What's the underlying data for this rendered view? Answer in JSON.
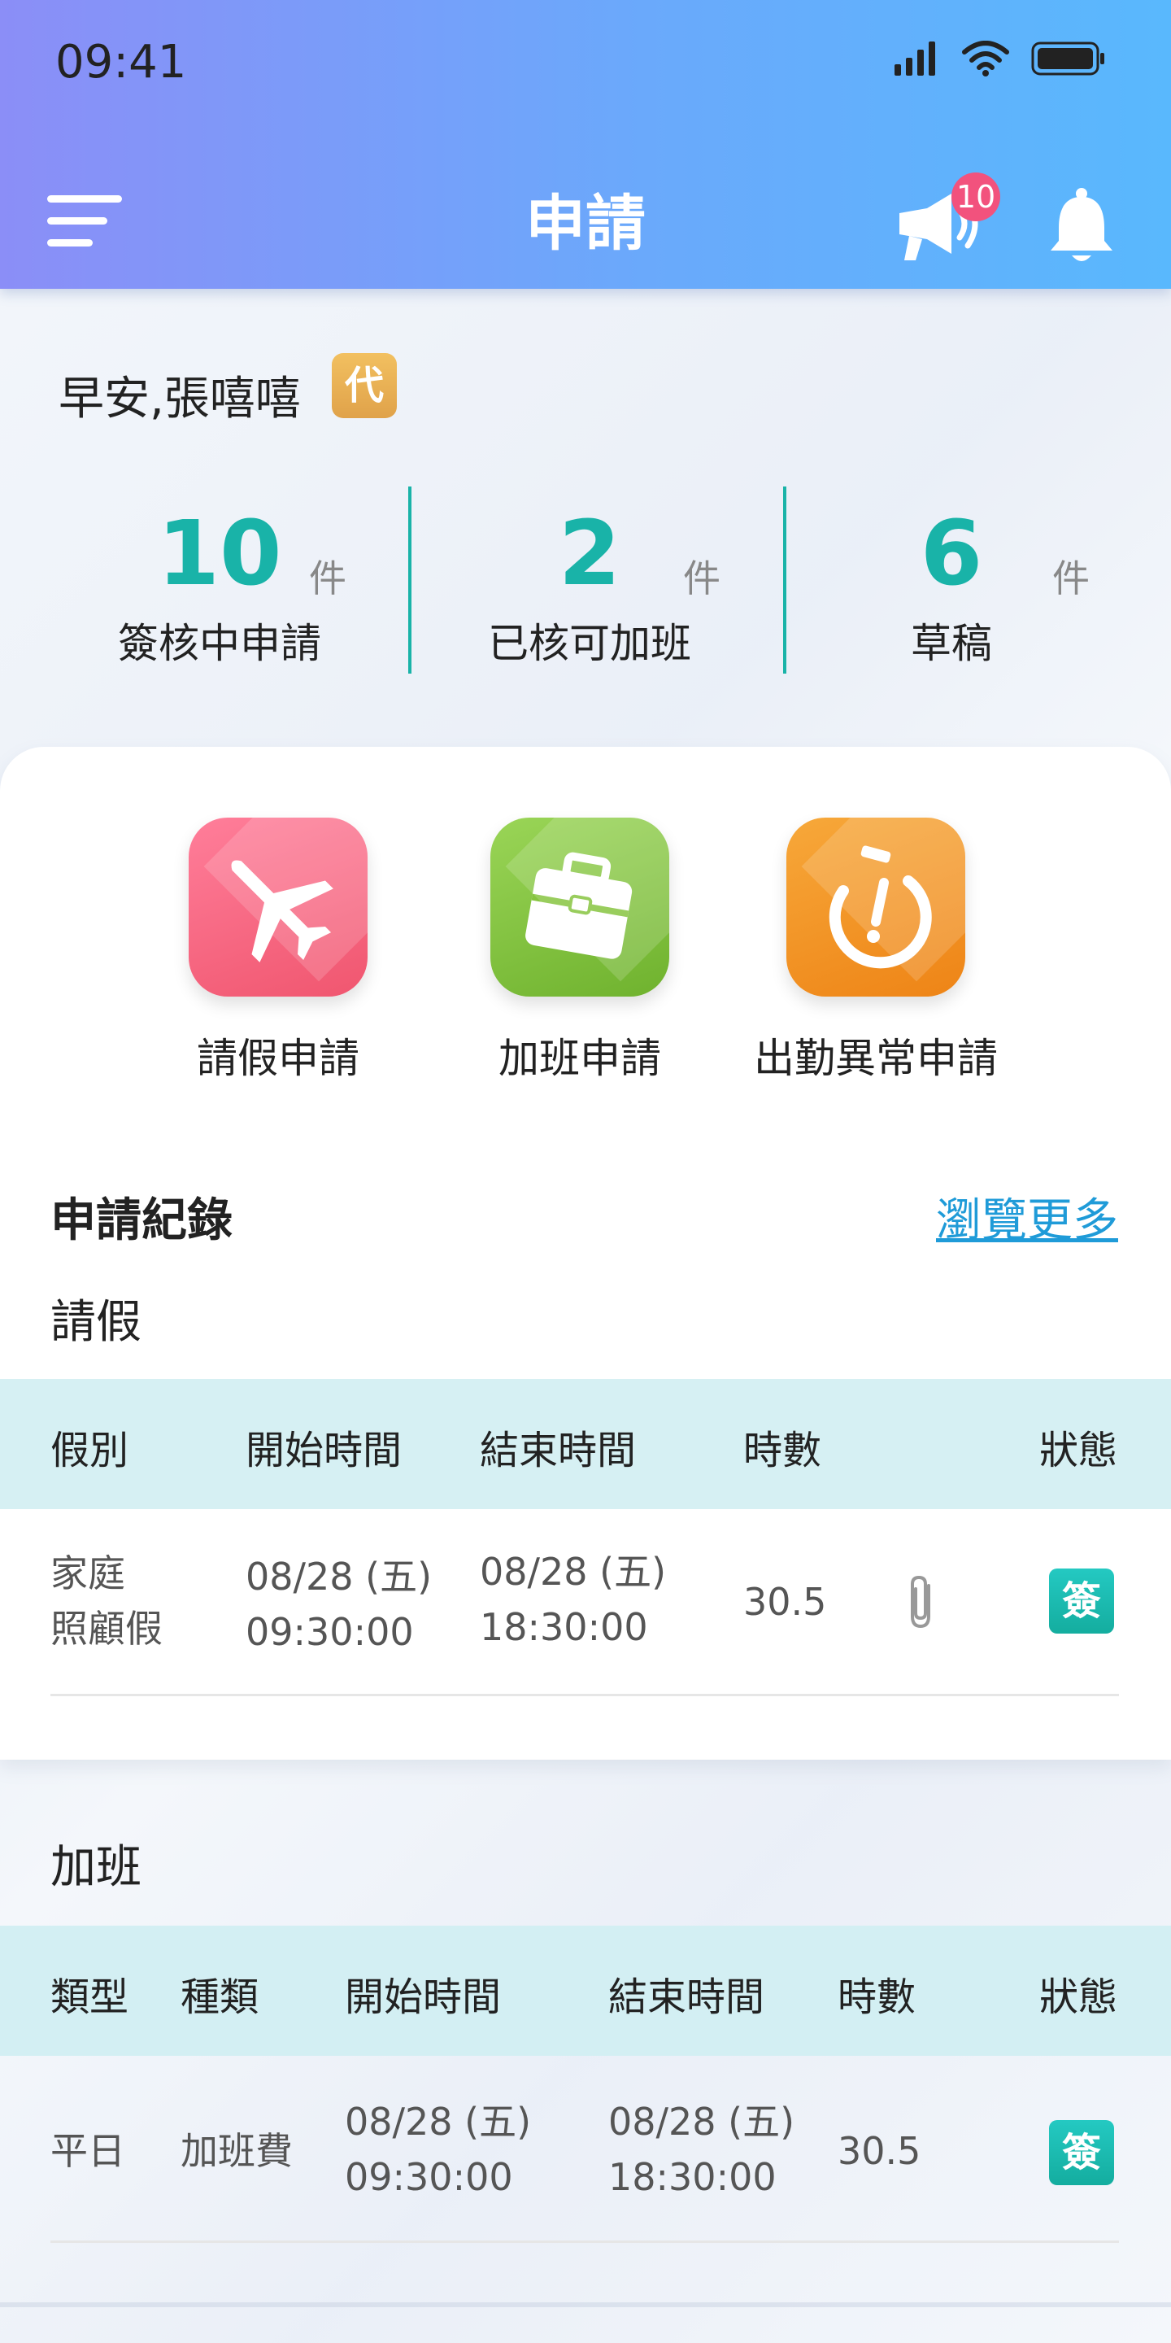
{
  "status_bar": {
    "time": "09:41"
  },
  "header": {
    "title": "申請",
    "announcement_badge": "10"
  },
  "greeting": {
    "text": "早安,張嘻嘻",
    "proxy_badge": "代"
  },
  "stats": [
    {
      "value": "10",
      "unit": "件",
      "label": "簽核中申請"
    },
    {
      "value": "2",
      "unit": "件",
      "label": "已核可加班"
    },
    {
      "value": "6",
      "unit": "件",
      "label": "草稿"
    }
  ],
  "quick_actions": [
    {
      "label": "請假申請",
      "color": "#f4647f"
    },
    {
      "label": "加班申請",
      "color": "#86c43f"
    },
    {
      "label": "出勤異常申請",
      "color": "#f3941f"
    }
  ],
  "records": {
    "title": "申請紀錄",
    "more_label": "瀏覽更多",
    "leave": {
      "title": "請假",
      "columns": [
        "假別",
        "開始時間",
        "結束時間",
        "時數",
        "狀態"
      ],
      "rows": [
        {
          "type_line1": "家庭",
          "type_line2": "照顧假",
          "start_date": "08/28 (五)",
          "start_time": "09:30:00",
          "end_date": "08/28 (五)",
          "end_time": "18:30:00",
          "hours": "30.5",
          "status": "簽"
        }
      ]
    },
    "overtime": {
      "title": "加班",
      "columns": [
        "類型",
        "種類",
        "開始時間",
        "結束時間",
        "時數",
        "狀態"
      ],
      "rows": [
        {
          "day_type": "平日",
          "kind": "加班費",
          "start_date": "08/28 (五)",
          "start_time": "09:30:00",
          "end_date": "08/28 (五)",
          "end_time": "18:30:00",
          "hours": "30.5",
          "status": "簽"
        }
      ]
    }
  },
  "colors": {
    "accent": "#19b3a8",
    "header_start": "#8b8ef7",
    "header_end": "#59b8fd",
    "link": "#1f9bd8"
  }
}
